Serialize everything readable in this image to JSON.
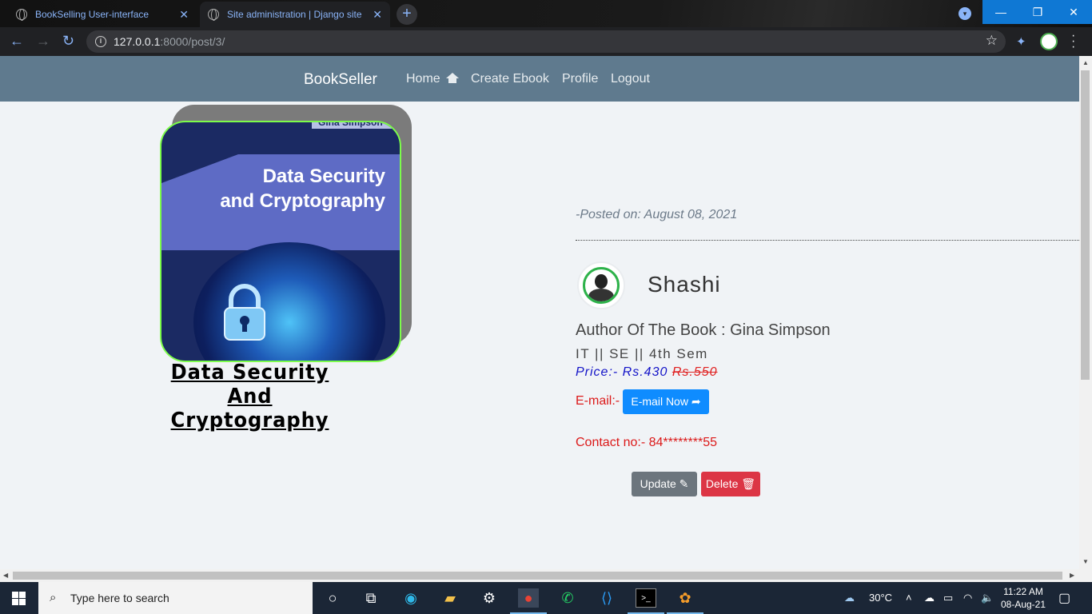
{
  "browser": {
    "tabs": [
      {
        "title": "BookSelling User-interface",
        "close": "✕"
      },
      {
        "title": "Site administration | Django site",
        "close": "✕"
      }
    ],
    "url_host": "127.0.0.1",
    "url_rest": ":8000/post/3/"
  },
  "nav": {
    "brand": "BookSeller",
    "links": [
      "Home",
      "Create Ebook",
      "Profile",
      "Logout"
    ]
  },
  "book": {
    "cover_author": "Gina Simpson",
    "cover_title_line1": "Data Security",
    "cover_title_line2": "and Cryptography",
    "title": "Data Security And Cryptography"
  },
  "post": {
    "posted_on": "-Posted on: August 08, 2021",
    "username": "Shashi",
    "author_line": "Author Of The Book : Gina Simpson",
    "dept": "IT || SE || 4th Sem",
    "price_label": "Price:- Rs.430",
    "old_price": "Rs.550",
    "email_label": "E-mail:-",
    "email_button": "E-mail Now",
    "contact": "Contact no:- 84********55",
    "update_button": "Update",
    "delete_button": "Delete"
  },
  "taskbar": {
    "search_placeholder": "Type here to search",
    "weather": "30°C",
    "time": "11:22 AM",
    "date": "08-Aug-21"
  }
}
